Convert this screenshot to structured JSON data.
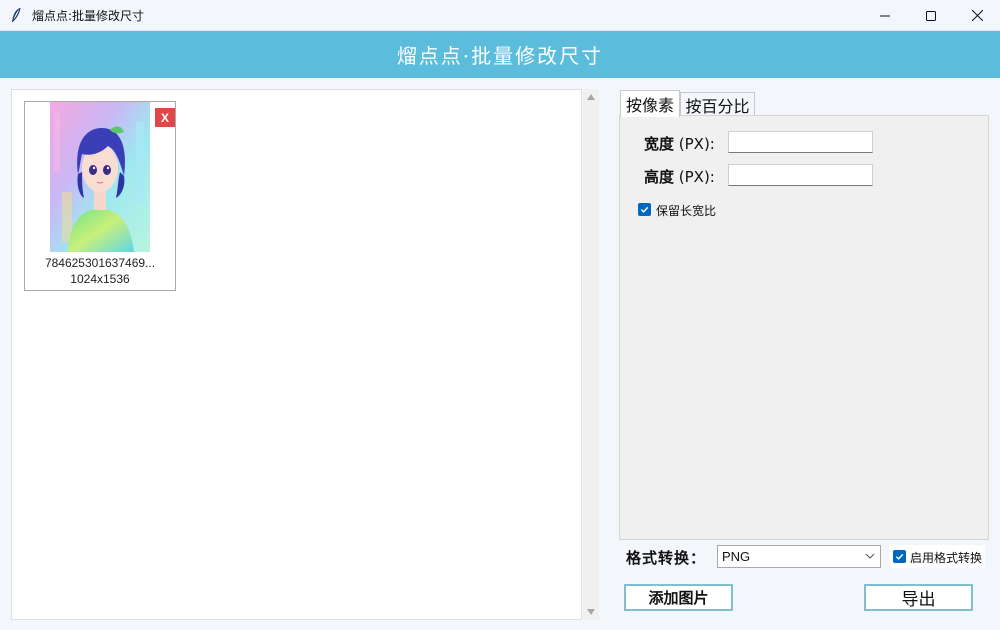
{
  "window": {
    "title": "熘点点:批量修改尺寸",
    "minimize_icon": "minimize-icon",
    "maximize_icon": "maximize-icon",
    "close_icon": "close-icon"
  },
  "banner": {
    "title": "熘点点·批量修改尺寸"
  },
  "images": [
    {
      "name": "784625301637469...",
      "dimensions": "1024x1536",
      "remove_label": "X"
    }
  ],
  "tabs": [
    {
      "label": "按像素",
      "active": true
    },
    {
      "label": "按百分比",
      "active": false
    }
  ],
  "pixel_form": {
    "width_label_bold": "宽度",
    "width_label_unit": " (PX):",
    "width_value": "",
    "height_label_bold": "高度",
    "height_label_unit": " (PX):",
    "height_value": "",
    "keep_ratio_label": "保留长宽比",
    "keep_ratio_checked": true
  },
  "format": {
    "label": "格式转换：",
    "selected": "PNG",
    "enable_label": "启用格式转换",
    "enable_checked": true
  },
  "actions": {
    "add_label": "添加图片",
    "export_label": "导出"
  },
  "colors": {
    "banner": "#5bbcdc",
    "checkbox": "#0067c0",
    "remove": "#e04848",
    "button_border": "#7fbfd0"
  }
}
